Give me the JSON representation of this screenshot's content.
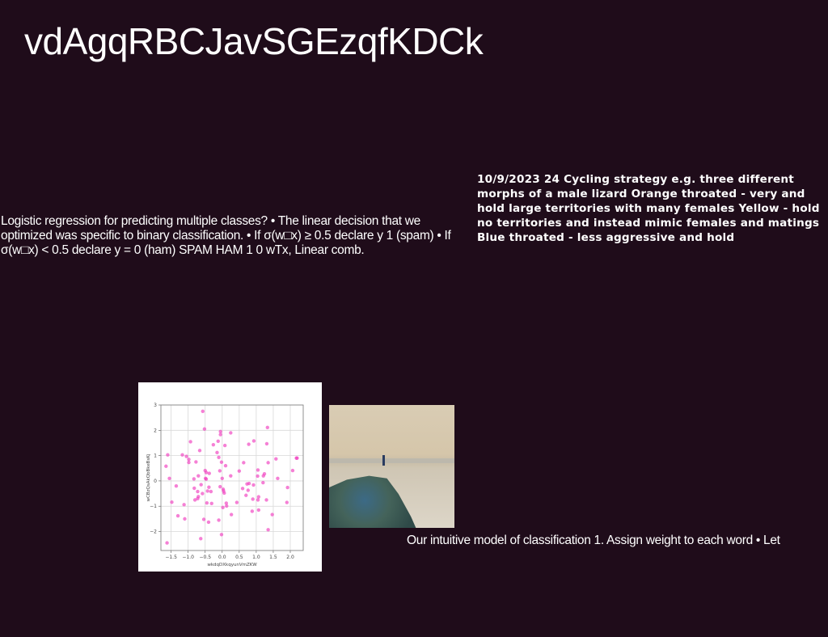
{
  "title": "vdAgqRBCJavSGEzqfKDCk",
  "left_text": "Logistic regression for predicting multiple classes? • The linear decision that we optimized was specific to binary classification. • If σ(w□x) ≥ 0.5 declare y 1 (spam) • If σ(w□x) < 0.5 declare y = 0 (ham) SPAM HAM 1 0 wTx, Linear comb.",
  "right_text": "10/9/2023 24 Cycling strategy e.g. three different morphs of a male lizard Orange throated - very and hold large territories with many females Yellow - hold no territories and instead mimic females and matings Blue throated - less aggressive and hold",
  "caption": "Our intuitive model of classification 1. Assign weight to each word • Let",
  "colors": {
    "background": "#1f0c1a",
    "points": "#f03cbe"
  },
  "chart_data": {
    "type": "scatter",
    "title": "",
    "xlabel": "wkdqDXkqyunVmZKW",
    "ylabel": "wCBzQsAkQbBkeBsKj",
    "xlim": [
      -1.8,
      2.38
    ],
    "ylim": [
      -2.75,
      3.0
    ],
    "xticks": [
      -1.5,
      -1.0,
      -0.5,
      0.0,
      0.5,
      1.0,
      1.5,
      2.0
    ],
    "xtick_labels": [
      "−1.5",
      "−1.0",
      "−0.5",
      "0.0",
      "0.5",
      "1.0",
      "1.5",
      "2.0"
    ],
    "yticks": [
      -2,
      -1,
      0,
      1,
      2,
      3
    ],
    "ytick_labels": [
      "−2",
      "−1",
      "0",
      "1",
      "2",
      "3"
    ],
    "grid": true,
    "points": [
      [
        -1.65,
        0.58
      ],
      [
        -1.6,
        1.03
      ],
      [
        -1.55,
        0.1
      ],
      [
        -1.62,
        -2.45
      ],
      [
        -1.48,
        -0.84
      ],
      [
        -1.35,
        -0.2
      ],
      [
        -1.3,
        -1.38
      ],
      [
        -1.17,
        1.03
      ],
      [
        -1.12,
        -0.94
      ],
      [
        -1.1,
        -1.5
      ],
      [
        -1.05,
        0.97
      ],
      [
        -0.98,
        0.85
      ],
      [
        -0.98,
        0.73
      ],
      [
        -0.93,
        1.55
      ],
      [
        -0.83,
        0.08
      ],
      [
        -0.82,
        -0.29
      ],
      [
        -0.8,
        -0.75
      ],
      [
        -0.77,
        0.75
      ],
      [
        -0.72,
        -0.42
      ],
      [
        -0.72,
        -0.7
      ],
      [
        -0.7,
        0.2
      ],
      [
        -0.7,
        -0.62
      ],
      [
        -0.66,
        1.2
      ],
      [
        -0.63,
        -2.28
      ],
      [
        -0.62,
        -0.15
      ],
      [
        -0.58,
        -0.5
      ],
      [
        -0.57,
        2.75
      ],
      [
        -0.54,
        -1.52
      ],
      [
        -0.52,
        2.05
      ],
      [
        -0.5,
        0.41
      ],
      [
        -0.49,
        0.1
      ],
      [
        -0.47,
        0.07
      ],
      [
        -0.47,
        0.33
      ],
      [
        -0.45,
        -0.87
      ],
      [
        -0.43,
        -0.4
      ],
      [
        -0.4,
        -1.63
      ],
      [
        -0.39,
        -0.25
      ],
      [
        -0.38,
        0.3
      ],
      [
        -0.33,
        -0.42
      ],
      [
        -0.31,
        -0.89
      ],
      [
        -0.26,
        1.43
      ],
      [
        -0.15,
        1.12
      ],
      [
        -0.12,
        1.57
      ],
      [
        -0.1,
        0.93
      ],
      [
        -0.1,
        -1.55
      ],
      [
        -0.07,
        0.4
      ],
      [
        -0.06,
        -0.23
      ],
      [
        -0.05,
        1.95
      ],
      [
        -0.05,
        1.83
      ],
      [
        -0.02,
        0.74
      ],
      [
        -0.02,
        -2.12
      ],
      [
        0.0,
        0.1
      ],
      [
        0.02,
        -1.05
      ],
      [
        0.03,
        -0.33
      ],
      [
        0.04,
        -0.4
      ],
      [
        0.06,
        -0.48
      ],
      [
        0.08,
        1.4
      ],
      [
        0.1,
        0.6
      ],
      [
        0.12,
        -0.88
      ],
      [
        0.13,
        -0.99
      ],
      [
        0.25,
        1.9
      ],
      [
        0.25,
        0.2
      ],
      [
        0.27,
        -1.33
      ],
      [
        0.43,
        -0.85
      ],
      [
        0.5,
        0.39
      ],
      [
        0.6,
        -0.3
      ],
      [
        0.63,
        0.72
      ],
      [
        0.7,
        -0.57
      ],
      [
        0.73,
        -0.12
      ],
      [
        0.76,
        -0.37
      ],
      [
        0.78,
        1.45
      ],
      [
        0.79,
        -0.1
      ],
      [
        0.88,
        -1.2
      ],
      [
        0.9,
        -0.72
      ],
      [
        0.92,
        -0.16
      ],
      [
        0.93,
        1.58
      ],
      [
        1.04,
        0.19
      ],
      [
        1.05,
        0.43
      ],
      [
        1.05,
        -0.75
      ],
      [
        1.07,
        -0.63
      ],
      [
        1.07,
        -1.15
      ],
      [
        1.2,
        -0.07
      ],
      [
        1.21,
        0.2
      ],
      [
        1.24,
        0.28
      ],
      [
        1.3,
        -0.75
      ],
      [
        1.31,
        1.47
      ],
      [
        1.33,
        2.11
      ],
      [
        1.35,
        0.72
      ],
      [
        1.35,
        -1.93
      ],
      [
        1.47,
        -1.33
      ],
      [
        1.58,
        0.87
      ],
      [
        1.63,
        0.1
      ],
      [
        1.9,
        -0.85
      ],
      [
        1.92,
        -0.26
      ],
      [
        2.07,
        0.41
      ],
      [
        2.18,
        0.9
      ],
      [
        2.2,
        0.9
      ]
    ]
  }
}
